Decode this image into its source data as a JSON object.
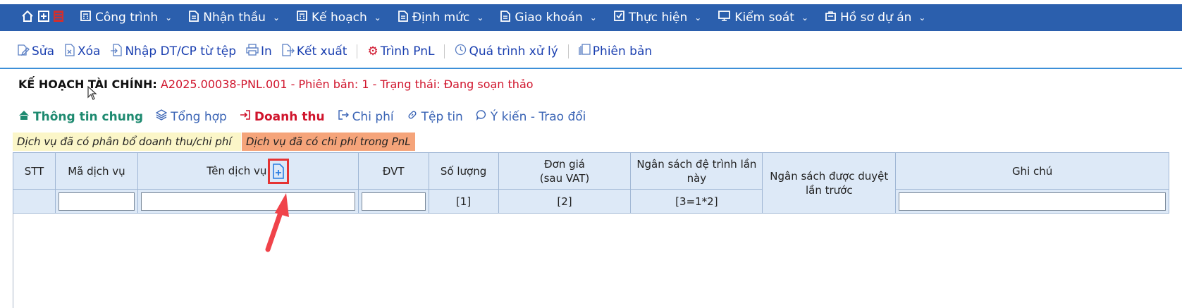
{
  "nav": {
    "items": [
      {
        "label": "Công trình",
        "icon": "calculator-icon"
      },
      {
        "label": "Nhận thầu",
        "icon": "document-icon"
      },
      {
        "label": "Kế hoạch",
        "icon": "calculator-icon"
      },
      {
        "label": "Định mức",
        "icon": "document-icon"
      },
      {
        "label": "Giao khoán",
        "icon": "document-icon"
      },
      {
        "label": "Thực hiện",
        "icon": "checkbox-icon"
      },
      {
        "label": "Kiểm soát",
        "icon": "monitor-icon"
      },
      {
        "label": "Hồ sơ dự án",
        "icon": "briefcase-icon"
      }
    ]
  },
  "toolbar": {
    "edit": "Sửa",
    "delete": "Xóa",
    "import": "Nhập DT/CP từ tệp",
    "print": "In",
    "export": "Kết xuất",
    "submit": "Trình PnL",
    "history": "Quá trình xử lý",
    "versions": "Phiên bản"
  },
  "title": {
    "label": "KẾ HOẠCH TÀI CHÍNH:",
    "value": "A2025.00038-PNL.001 - Phiên bản: 1 - Trạng thái: Đang soạn thảo"
  },
  "tabs": {
    "general": "Thông tin chung",
    "summary": "Tổng hợp",
    "revenue": "Doanh thu",
    "cost": "Chi phí",
    "files": "Tệp tin",
    "comments": "Ý kiến - Trao đổi"
  },
  "legend": {
    "allocated": "Dịch vụ đã có phân bổ doanh thu/chi phí",
    "has_cost": "Dịch vụ đã có chi phí trong PnL"
  },
  "table": {
    "headers": {
      "stt": "STT",
      "code": "Mã dịch vụ",
      "name": "Tên dịch vụ",
      "unit": "ĐVT",
      "qty": "Số lượng",
      "price_line1": "Đơn giá",
      "price_line2": "(sau VAT)",
      "budget_line1": "Ngân sách đệ trình lần",
      "budget_line2": "này",
      "approved_line1": "Ngân sách được duyệt",
      "approved_line2": "lần trước",
      "note": "Ghi chú"
    },
    "formula": {
      "qty": "[1]",
      "price": "[2]",
      "budget": "[3=1*2]"
    }
  },
  "colors": {
    "nav_bg": "#2b5fad",
    "accent_red": "#d0142c",
    "legend_yellow": "#fbf6c8",
    "legend_orange": "#f5a47a",
    "table_bg": "#dde9f7"
  }
}
